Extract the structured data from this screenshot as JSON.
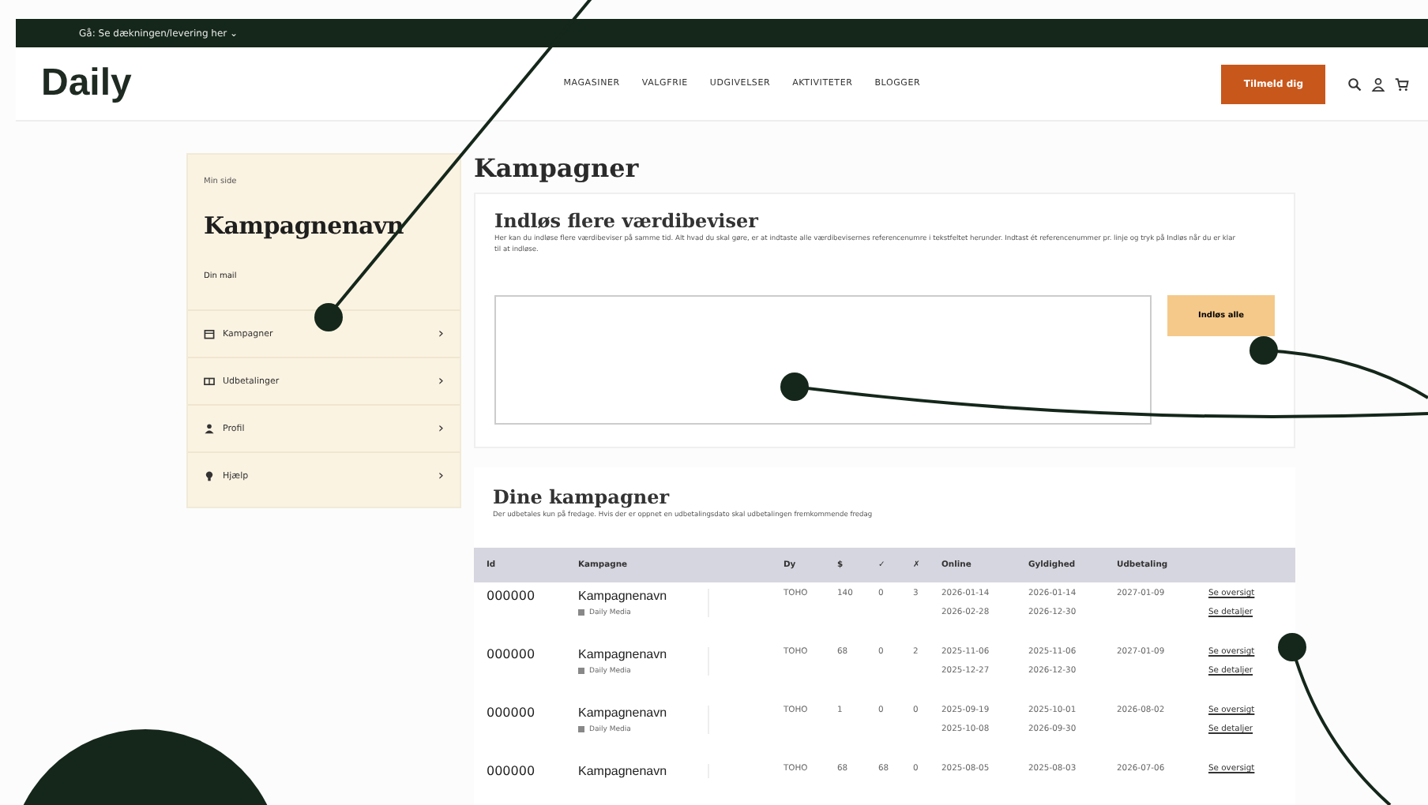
{
  "top_bar": {
    "text": "Gå: Se dækningen/levering her ⌄"
  },
  "header": {
    "logo": "Daily",
    "nav": [
      "MAGASINER",
      "VALGFRIE",
      "UDGIVELSER",
      "AKTIVITETER",
      "BLOGGER"
    ],
    "cta": "Tilmeld dig"
  },
  "sidebar": {
    "label": "Min side",
    "title": "Kampagnenavn",
    "email_label": "Din mail",
    "items": [
      {
        "label": "Kampagner",
        "chevron": "›"
      },
      {
        "label": "Udbetalinger",
        "chevron": "›"
      },
      {
        "label": "Profil",
        "chevron": "›"
      },
      {
        "label": "Hjælp",
        "chevron": "›"
      }
    ]
  },
  "page_title": "Kampagner",
  "upload": {
    "title": "Indløs flere værdibeviser",
    "text": "Her kan du indløse flere værdibeviser på samme tid. Alt hvad du skal gøre, er at indtaste alle værdibevisernes referencenumre i tekstfeltet herunder. Indtast ét referencenummer pr. linje og tryk på Indløs når du er klar til at indløse.",
    "button": "Indløs alle"
  },
  "campaigns": {
    "title": "Dine kampagner",
    "text": "Der udbetales kun på fredage. Hvis der er oppnet en udbetalingsdato skal udbetalingen fremkommende fredag",
    "columns": [
      "Id",
      "Kampagne",
      "Dy",
      "$",
      "✓",
      "✗",
      "Online",
      "Gyldighed",
      "Udbetaling"
    ],
    "rows": [
      {
        "id": "000000",
        "name": "Kampagnenavn",
        "media": "Daily Media",
        "c3": "TOHO",
        "c4": "140",
        "c5": "0",
        "c6": "3",
        "online": [
          "2026-01-14",
          "2026-02-28"
        ],
        "valid": [
          "2026-01-14",
          "2026-12-30"
        ],
        "payout": "2027-01-09",
        "links": [
          "Se oversigt",
          "Se detaljer"
        ]
      },
      {
        "id": "000000",
        "name": "Kampagnenavn",
        "media": "Daily Media",
        "c3": "TOHO",
        "c4": "68",
        "c5": "0",
        "c6": "2",
        "online": [
          "2025-11-06",
          "2025-12-27"
        ],
        "valid": [
          "2025-11-06",
          "2026-12-30"
        ],
        "payout": "2027-01-09",
        "links": [
          "Se oversigt",
          "Se detaljer"
        ]
      },
      {
        "id": "000000",
        "name": "Kampagnenavn",
        "media": "Daily Media",
        "c3": "TOHO",
        "c4": "1",
        "c5": "0",
        "c6": "0",
        "online": [
          "2025-09-19",
          "2025-10-08"
        ],
        "valid": [
          "2025-10-01",
          "2026-09-30"
        ],
        "payout": "2026-08-02",
        "links": [
          "Se oversigt",
          "Se detaljer"
        ]
      },
      {
        "id": "000000",
        "name": "Kampagnenavn",
        "c3": "TOHO",
        "c4": "68",
        "c5": "68",
        "c6": "0",
        "online": [
          "2025-08-05"
        ],
        "valid": [
          "2025-08-03"
        ],
        "payout": "2026-07-06",
        "links": [
          "Se oversigt"
        ]
      }
    ]
  }
}
